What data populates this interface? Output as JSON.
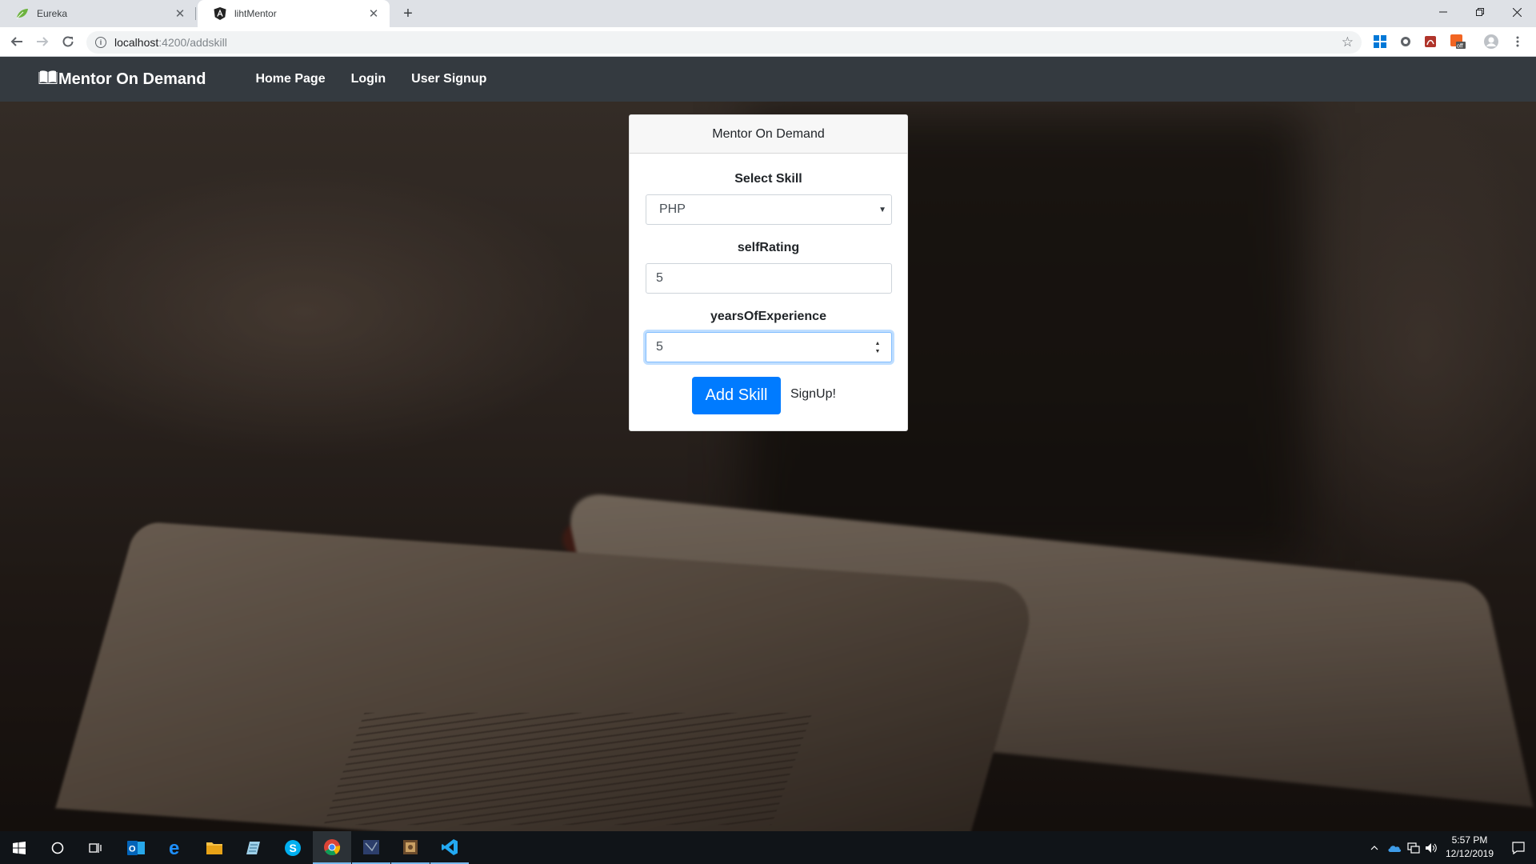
{
  "browser": {
    "tabs": [
      {
        "title": "Eureka",
        "active": false,
        "favicon": "leaf-icon"
      },
      {
        "title": "lihtMentor",
        "active": true,
        "favicon": "angular-icon"
      }
    ],
    "url_host": "localhost",
    "url_path": ":4200/addskill"
  },
  "navbar": {
    "brand": "Mentor On Demand",
    "links": [
      "Home Page",
      "Login",
      "User Signup"
    ]
  },
  "card": {
    "header": "Mentor On Demand",
    "skill_label": "Select Skill",
    "skill_value": "PHP",
    "self_rating_label": "selfRating",
    "self_rating_value": "5",
    "years_label": "yearsOfExperience",
    "years_value": "5",
    "submit_label": "Add Skill",
    "signup_link": "SignUp!"
  },
  "taskbar": {
    "clock_time": "5:57 PM",
    "clock_date": "12/12/2019"
  },
  "colors": {
    "navbar_bg": "#343a40",
    "primary": "#007bff",
    "taskbar_bg": "#101418"
  }
}
